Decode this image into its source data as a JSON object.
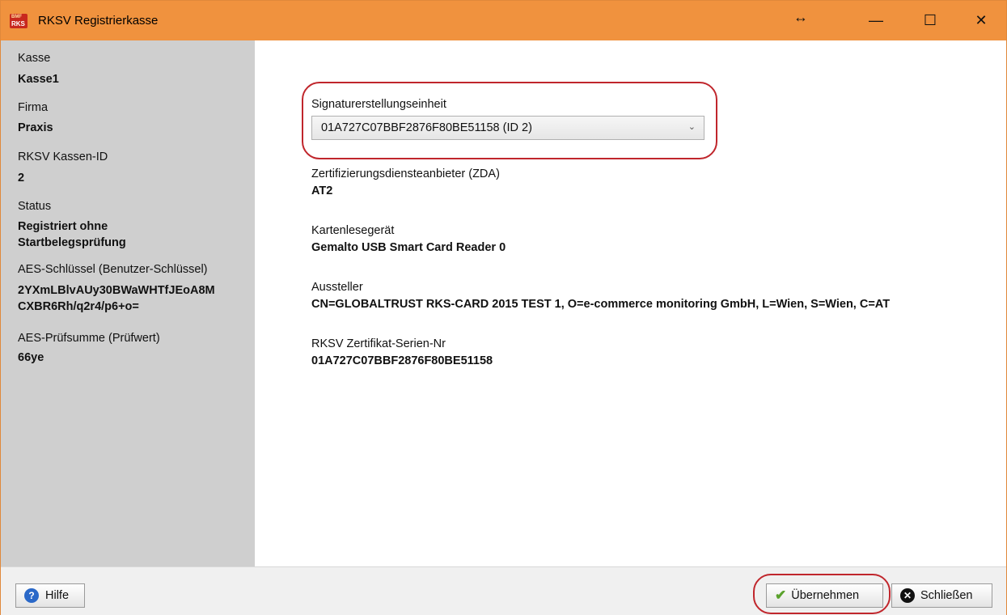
{
  "window": {
    "title": "RKSV Registrierkasse",
    "icon_text_top": "BMF",
    "icon_text_bottom": "RKS",
    "resize_glyph": "↔",
    "minimize_glyph": "—",
    "maximize_glyph": "☐",
    "close_glyph": "✕"
  },
  "sidebar": {
    "kasse_label": "Kasse",
    "kasse_value": "Kasse1",
    "firma_label": "Firma",
    "firma_value": "Praxis",
    "kassen_id_label": "RKSV Kassen-ID",
    "kassen_id_value": "2",
    "status_label": "Status",
    "status_value_line1": "Registriert ohne",
    "status_value_line2": "Startbelegsprüfung",
    "aes_key_label": "AES-Schlüssel (Benutzer-Schlüssel)",
    "aes_key_line1": "2YXmLBlvAUy30BWaWHTfJEoA8M",
    "aes_key_line2": "CXBR6Rh/q2r4/p6+o=",
    "aes_checksum_label": "AES-Prüfsumme (Prüfwert)",
    "aes_checksum_value": "66ye"
  },
  "main": {
    "sig_unit_label": "Signaturerstellungseinheit",
    "sig_unit_selected": "01A727C07BBF2876F80BE51158  (ID 2)",
    "zda_label": "Zertifizierungsdiensteanbieter (ZDA)",
    "zda_value": "AT2",
    "reader_label": "Kartenlesegerät",
    "reader_value": "Gemalto USB Smart Card Reader 0",
    "issuer_label": "Aussteller",
    "issuer_value": "CN=GLOBALTRUST RKS-CARD 2015 TEST 1, O=e-commerce monitoring GmbH, L=Wien, S=Wien, C=AT",
    "serial_label": "RKSV Zertifikat-Serien-Nr",
    "serial_value": "01A727C07BBF2876F80BE51158"
  },
  "footer": {
    "help_label": "Hilfe",
    "apply_label": "Übernehmen",
    "close_label": "Schließen"
  },
  "colors": {
    "titlebar": "#f0923e",
    "sidebar": "#cfcfcf",
    "highlight_ring": "#c0262c"
  }
}
